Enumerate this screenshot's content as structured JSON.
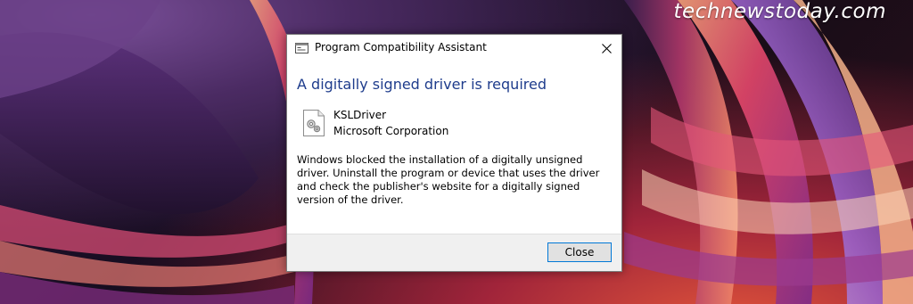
{
  "watermark": {
    "text": "technewstoday.com"
  },
  "dialog": {
    "title": "Program Compatibility Assistant",
    "heading": "A digitally signed driver is required",
    "driver_name": "KSLDriver",
    "driver_company": "Microsoft Corporation",
    "message": "Windows blocked the installation of a digitally unsigned driver.  Uninstall the program or device that uses the driver and check the publisher's website for a digitally signed version of the driver.",
    "close_label": "Close",
    "icons": {
      "app": "dialog-window-icon",
      "close": "close-icon",
      "driver": "gear-document-icon"
    }
  },
  "colors": {
    "heading": "#1e3c8c",
    "button_border": "#0078d7",
    "footer_bg": "#f0f0f0"
  }
}
